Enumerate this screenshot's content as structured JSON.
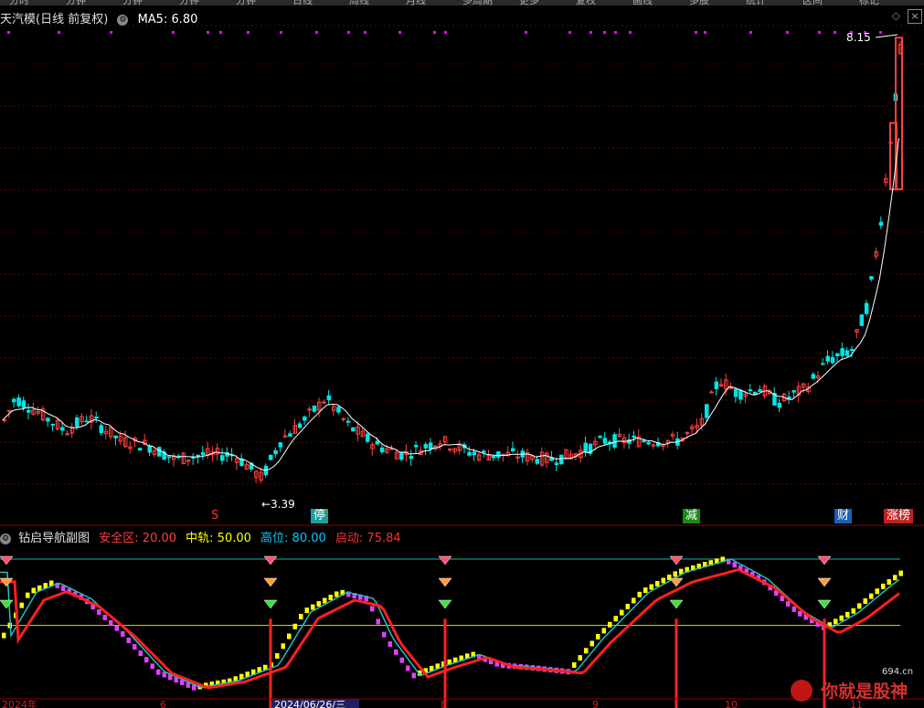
{
  "window": {
    "title": "天汽模(日线 前复权)",
    "ma_label": "MA5: 6.80",
    "toolbar_fragments": [
      "分时",
      "分钟",
      "分钟",
      "分钟",
      "分钟",
      "日线",
      "周线",
      "月线",
      "多周期",
      "更多",
      "复权",
      "画线",
      "多股",
      "统计",
      "区间",
      "标记"
    ]
  },
  "price_chart": {
    "high_label": "8.15",
    "low_label": "←3.39",
    "badges": [
      {
        "text": "S",
        "color": "#ff3030",
        "bg": "none"
      },
      {
        "text": "停",
        "color": "#ffffff",
        "bg": "#1aa0a0"
      },
      {
        "text": "减",
        "color": "#ffffff",
        "bg": "#1a8a1a"
      },
      {
        "text": "财",
        "color": "#ffffff",
        "bg": "#1a60b0"
      },
      {
        "text": "涨榜",
        "color": "#ffffff",
        "bg": "#c02020"
      }
    ],
    "colors": {
      "up": "#ff4040",
      "down": "#00e5e5",
      "ma": "#ffffff",
      "marker": "#ff00ff"
    }
  },
  "indicator": {
    "name": "钻启导航副图",
    "safe_zone": "安全区: 20.00",
    "mid_rail": "中轨: 50.00",
    "high_pos": "高位: 80.00",
    "start": "启动: 75.84",
    "colors": {
      "safe": "#ff4040",
      "mid": "#ffff00",
      "high": "#00ccff",
      "start": "#ff3030"
    }
  },
  "x_axis": {
    "date_label": "2024/06/26/三",
    "fragments": [
      "2024年",
      "6",
      "8",
      "9",
      "10",
      "11"
    ]
  },
  "watermark": {
    "text": "你就是股神",
    "site": "694.cn"
  }
}
